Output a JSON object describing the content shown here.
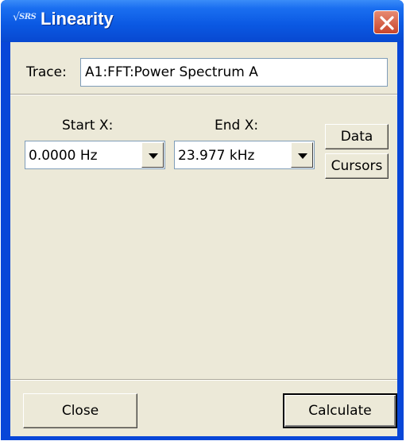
{
  "window": {
    "title": "Linearity",
    "logo_text": "SRS"
  },
  "trace": {
    "label": "Trace:",
    "value": "A1:FFT:Power Spectrum A"
  },
  "range": {
    "start_label": "Start X:",
    "start_value": "0.0000 Hz",
    "end_label": "End X:",
    "end_value": "23.977 kHz"
  },
  "source_buttons": {
    "data_label": "Data",
    "cursors_label": "Cursors"
  },
  "footer": {
    "close_label": "Close",
    "calculate_label": "Calculate"
  },
  "colors": {
    "titlebar": "#0a58e2",
    "client_bg": "#ece9d8",
    "close_button": "#d0553b"
  }
}
